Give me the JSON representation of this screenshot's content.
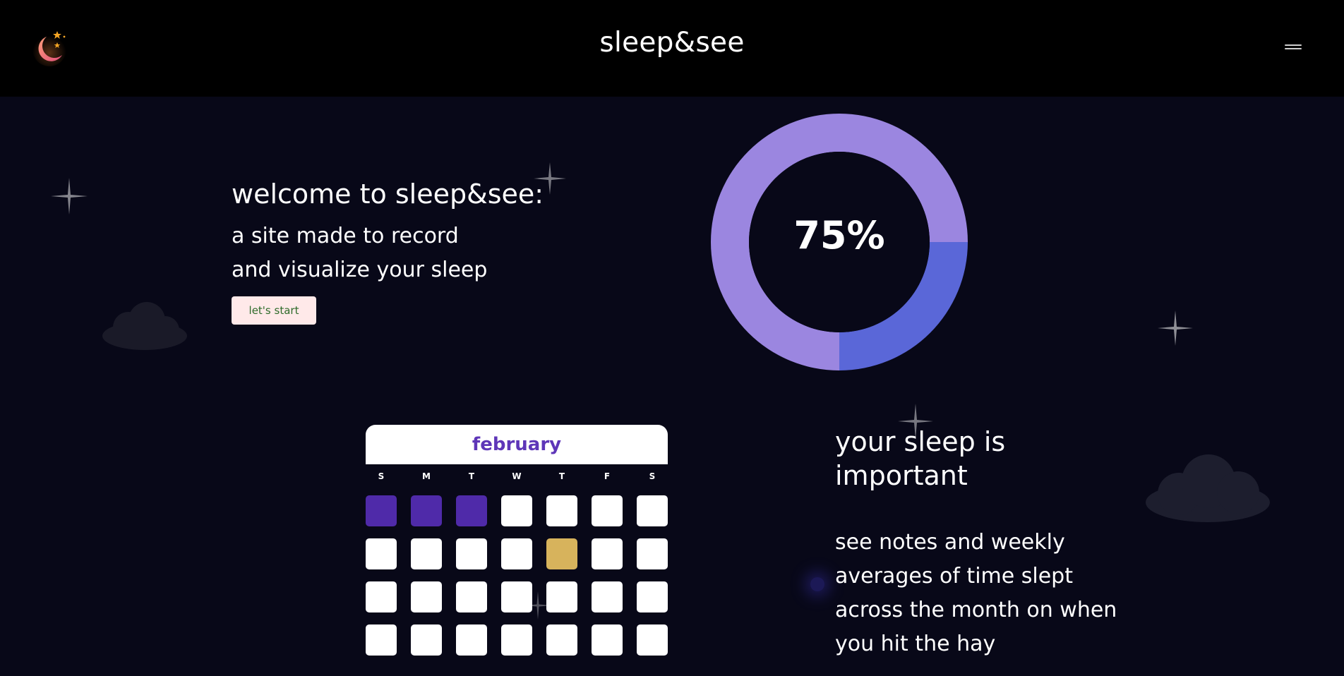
{
  "header": {
    "title": "sleep&see",
    "logo_icon": "moon-stars-icon",
    "menu_icon": "hamburger-menu-icon"
  },
  "hero": {
    "heading": "welcome to sleep&see:",
    "subtitle_line1": "a site made to record",
    "subtitle_line2": "and visualize your sleep",
    "cta_label": "let's start"
  },
  "chart_data": {
    "type": "pie",
    "variant": "donut",
    "center_label": "75%",
    "slices": [
      {
        "value": 75,
        "color": "#9b86e0"
      },
      {
        "value": 25,
        "color": "#5a67d8"
      }
    ]
  },
  "calendar": {
    "month": "february",
    "weekdays": [
      "S",
      "M",
      "T",
      "W",
      "T",
      "F",
      "S"
    ],
    "weeks": [
      [
        "slept",
        "slept",
        "slept",
        "empty",
        "empty",
        "empty",
        "empty"
      ],
      [
        "empty",
        "empty",
        "empty",
        "empty",
        "today",
        "empty",
        "empty"
      ],
      [
        "empty",
        "empty",
        "empty",
        "empty",
        "empty",
        "empty",
        "empty"
      ],
      [
        "empty",
        "empty",
        "empty",
        "empty",
        "empty",
        "empty",
        "empty"
      ]
    ]
  },
  "info": {
    "heading_line1": "your sleep is",
    "heading_line2": "important",
    "text_line1": "see notes and weekly",
    "text_line2": "averages of time slept",
    "text_line3": "across the month on when",
    "text_line4": "you hit the hay"
  },
  "colors": {
    "background": "#080818",
    "topbar": "#000000",
    "slept_cell": "#4f2aa9",
    "today_cell": "#d7b35c",
    "month_label": "#5e36b8",
    "cta_background": "#ffe9e9",
    "cta_text": "#2e6b2a"
  }
}
